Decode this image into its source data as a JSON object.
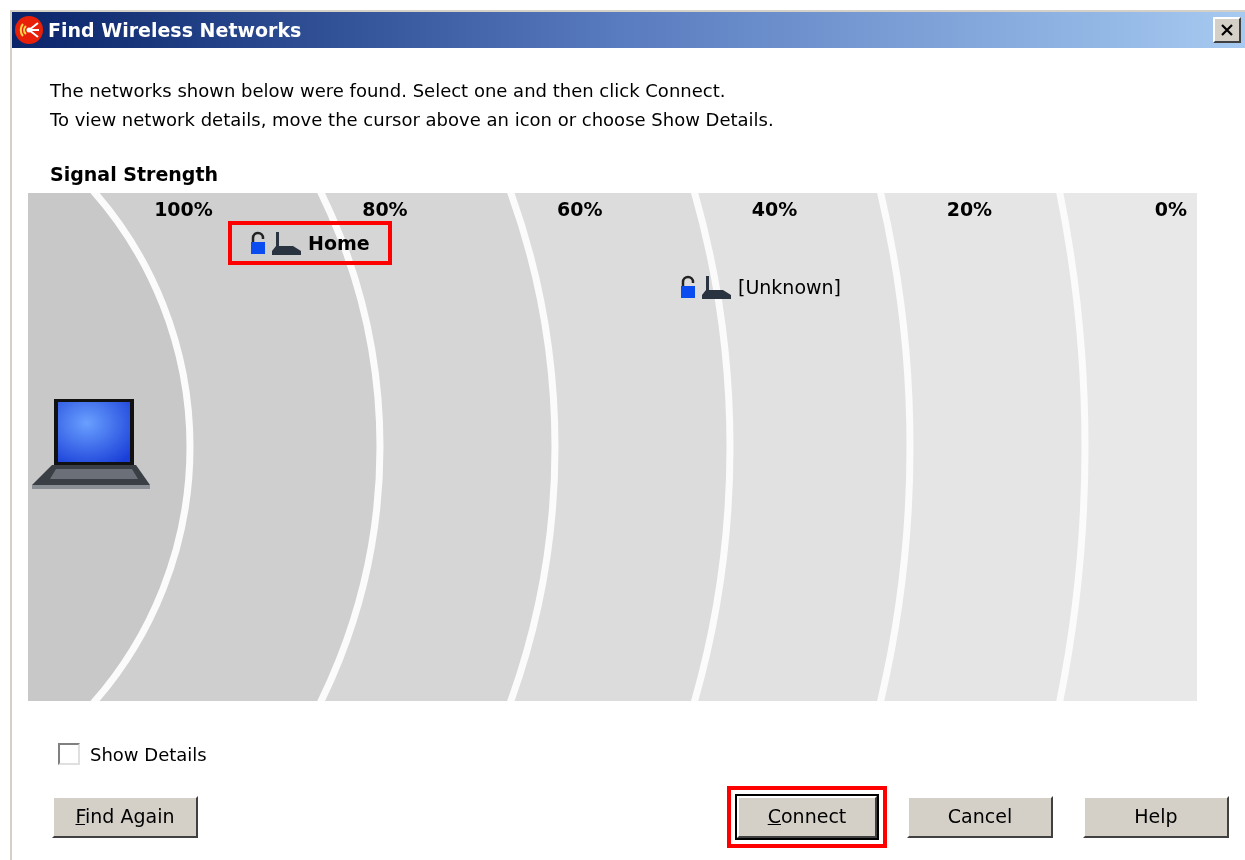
{
  "window": {
    "title": "Find Wireless Networks"
  },
  "intro": [
    "The networks shown below were found. Select one and then click Connect.",
    "To view network details, move the cursor above an icon or choose Show Details."
  ],
  "signal_strength": {
    "heading": "Signal Strength",
    "scale": [
      "100%",
      "80%",
      "60%",
      "40%",
      "20%",
      "0%"
    ]
  },
  "networks": [
    {
      "name": "Home",
      "selected": true,
      "highlighted": true
    },
    {
      "name": "[Unknown]",
      "selected": false,
      "highlighted": false
    }
  ],
  "show_details": {
    "label": "Show Details",
    "checked": false
  },
  "buttons": [
    {
      "label": "Find Again",
      "mnemonic": true,
      "default": false,
      "highlighted": false
    },
    {
      "label": "Connect",
      "mnemonic": true,
      "default": true,
      "highlighted": true
    },
    {
      "label": "Cancel",
      "mnemonic": false,
      "default": false,
      "highlighted": false
    },
    {
      "label": "Help",
      "mnemonic": false,
      "default": false,
      "highlighted": false
    }
  ]
}
